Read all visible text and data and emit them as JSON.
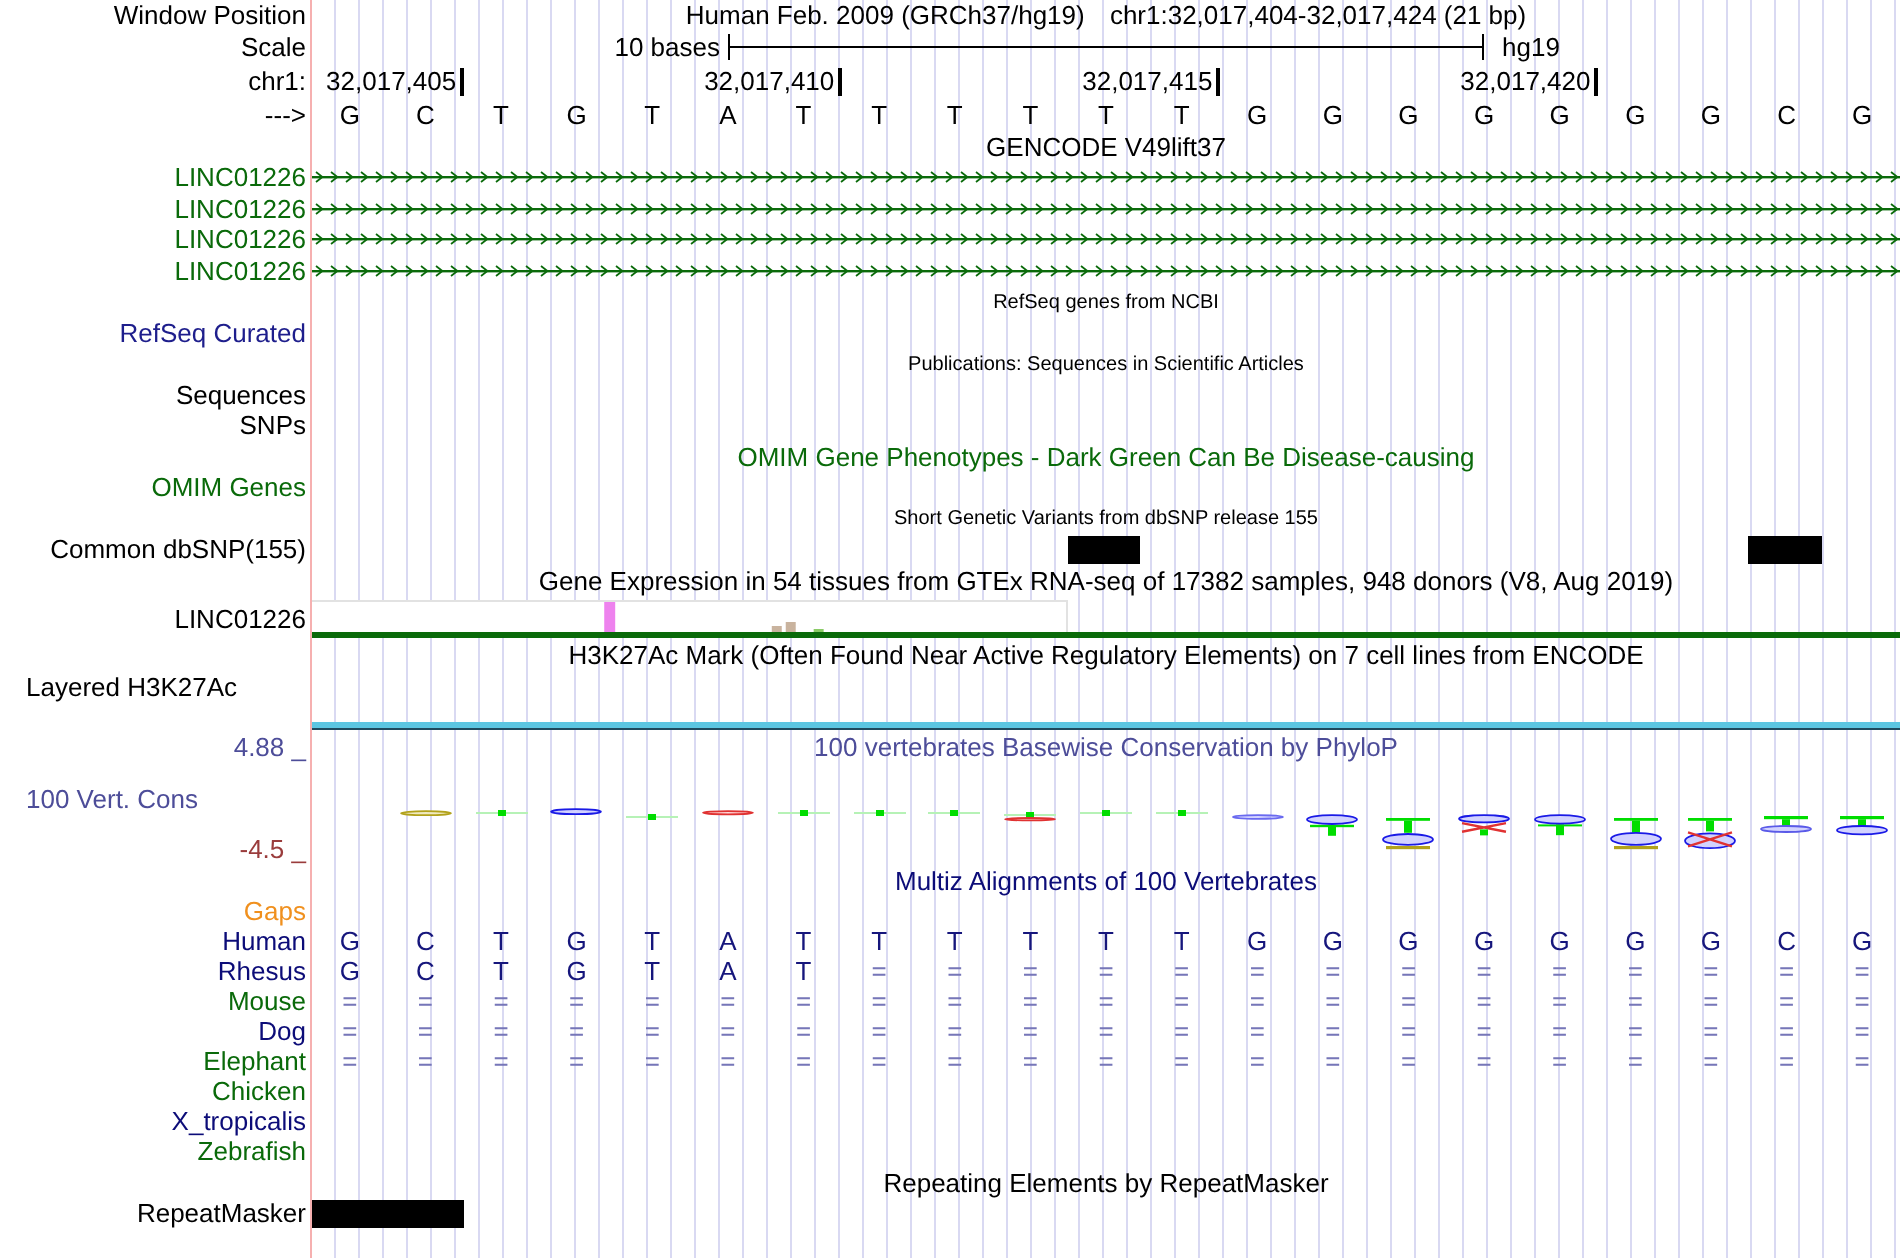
{
  "header": {
    "label": "Window Position",
    "assembly": "Human Feb. 2009 (GRCh37/hg19)",
    "position": "chr1:32,017,404-32,017,424 (21 bp)"
  },
  "scale": {
    "label": "Scale",
    "length": "10 bases",
    "assembly": "hg19"
  },
  "ruler": {
    "label": "chr1:",
    "ticks": [
      "32,017,405",
      "32,017,410",
      "32,017,415",
      "32,017,420"
    ]
  },
  "sequence": {
    "label": "--->",
    "bases": [
      "G",
      "C",
      "T",
      "G",
      "T",
      "A",
      "T",
      "T",
      "T",
      "T",
      "T",
      "T",
      "G",
      "G",
      "G",
      "G",
      "G",
      "G",
      "G",
      "C",
      "G"
    ]
  },
  "tracks": [
    {
      "kind": "title",
      "text": "GENCODE V49lift37",
      "color": "#000000"
    },
    {
      "kind": "gene",
      "label": "LINC01226",
      "color": "#0a6a0a"
    },
    {
      "kind": "gene",
      "label": "LINC01226",
      "color": "#0a6a0a"
    },
    {
      "kind": "gene",
      "label": "LINC01226",
      "color": "#0a6a0a"
    },
    {
      "kind": "gene",
      "label": "LINC01226",
      "color": "#0a6a0a"
    },
    {
      "kind": "note",
      "text": "RefSeq genes from NCBI",
      "color": "#000000"
    },
    {
      "kind": "label",
      "label": "RefSeq Curated",
      "color": "#1e1e8c"
    },
    {
      "kind": "note",
      "text": "Publications: Sequences in Scientific Articles",
      "color": "#000000"
    },
    {
      "kind": "label",
      "label": "Sequences",
      "color": "#000000"
    },
    {
      "kind": "label",
      "label": "SNPs",
      "color": "#000000"
    },
    {
      "kind": "title",
      "text": "OMIM Gene Phenotypes - Dark Green Can Be Disease-causing",
      "color": "#0a6a0a"
    },
    {
      "kind": "label",
      "label": "OMIM Genes",
      "color": "#0a6a0a"
    },
    {
      "kind": "note",
      "text": "Short Genetic Variants from dbSNP release 155",
      "color": "#000000"
    },
    {
      "kind": "features",
      "label": "Common dbSNP(155)",
      "color": "#000000",
      "cells": [
        {
          "kind": "blank"
        },
        {
          "kind": "blank"
        },
        {
          "kind": "blank"
        },
        {
          "kind": "blank"
        },
        {
          "kind": "blank"
        },
        {
          "kind": "blank"
        },
        {
          "kind": "blank"
        },
        {
          "kind": "blank"
        },
        {
          "kind": "blank"
        },
        {
          "kind": "blank"
        },
        {
          "kind": "variant"
        },
        {
          "kind": "blank"
        },
        {
          "kind": "blank"
        },
        {
          "kind": "blank"
        },
        {
          "kind": "blank"
        },
        {
          "kind": "blank"
        },
        {
          "kind": "blank"
        },
        {
          "kind": "blank"
        },
        {
          "kind": "blank"
        },
        {
          "kind": "variant"
        },
        {
          "kind": "blank"
        }
      ]
    },
    {
      "kind": "title",
      "text": "Gene Expression in 54 tissues from GTEx RNA-seq of 17382 samples, 948 donors (V8, Aug 2019)",
      "color": "#000000"
    },
    {
      "kind": "expression",
      "label": "LINC01226",
      "color": "#000000"
    },
    {
      "kind": "title",
      "text": "H3K27Ac Mark (Often Found Near Active Regulatory Elements) on 7 cell lines from ENCODE",
      "color": "#000000"
    },
    {
      "kind": "signal",
      "label": "Layered H3K27Ac",
      "color": "#000000"
    },
    {
      "kind": "conservation",
      "title": "100 vertebrates Basewise Conservation by PhyloP",
      "label": "100 Vert. Cons",
      "max": "4.88 _",
      "min": "-4.5 _",
      "color": "#4d4d99"
    },
    {
      "kind": "title",
      "text": "Multiz Alignments of 100 Vertebrates",
      "color": "#0c0c78"
    },
    {
      "kind": "label",
      "label": "Gaps",
      "color": "#f0901e"
    },
    {
      "kind": "alignment",
      "label": "Human",
      "color": "#0c0c78",
      "cells": [
        {
          "text": "G",
          "kind": "base"
        },
        {
          "text": "C",
          "kind": "base"
        },
        {
          "text": "T",
          "kind": "base"
        },
        {
          "text": "G",
          "kind": "base"
        },
        {
          "text": "T",
          "kind": "base"
        },
        {
          "text": "A",
          "kind": "base"
        },
        {
          "text": "T",
          "kind": "base"
        },
        {
          "text": "T",
          "kind": "base"
        },
        {
          "text": "T",
          "kind": "base"
        },
        {
          "text": "T",
          "kind": "base"
        },
        {
          "text": "T",
          "kind": "base"
        },
        {
          "text": "T",
          "kind": "base"
        },
        {
          "text": "G",
          "kind": "base"
        },
        {
          "text": "G",
          "kind": "base"
        },
        {
          "text": "G",
          "kind": "base"
        },
        {
          "text": "G",
          "kind": "base"
        },
        {
          "text": "G",
          "kind": "base"
        },
        {
          "text": "G",
          "kind": "base"
        },
        {
          "text": "G",
          "kind": "base"
        },
        {
          "text": "C",
          "kind": "base"
        },
        {
          "text": "G",
          "kind": "base"
        }
      ]
    },
    {
      "kind": "alignment",
      "label": "Rhesus",
      "color": "#0c0c78",
      "cells": [
        {
          "text": "G",
          "kind": "base"
        },
        {
          "text": "C",
          "kind": "base"
        },
        {
          "text": "T",
          "kind": "base"
        },
        {
          "text": "G",
          "kind": "base"
        },
        {
          "text": "T",
          "kind": "base"
        },
        {
          "text": "A",
          "kind": "base"
        },
        {
          "text": "T",
          "kind": "base"
        },
        {
          "text": "=",
          "kind": "match"
        },
        {
          "text": "=",
          "kind": "match"
        },
        {
          "text": "=",
          "kind": "match"
        },
        {
          "text": "=",
          "kind": "match"
        },
        {
          "text": "=",
          "kind": "match"
        },
        {
          "text": "=",
          "kind": "match"
        },
        {
          "text": "=",
          "kind": "match"
        },
        {
          "text": "=",
          "kind": "match"
        },
        {
          "text": "=",
          "kind": "match"
        },
        {
          "text": "=",
          "kind": "match"
        },
        {
          "text": "=",
          "kind": "match"
        },
        {
          "text": "=",
          "kind": "match"
        },
        {
          "text": "=",
          "kind": "match"
        },
        {
          "text": "=",
          "kind": "match"
        }
      ]
    },
    {
      "kind": "alignment",
      "label": "Mouse",
      "color": "#0a6a0a",
      "cells": [
        {
          "text": "=",
          "kind": "match"
        },
        {
          "text": "=",
          "kind": "match"
        },
        {
          "text": "=",
          "kind": "match"
        },
        {
          "text": "=",
          "kind": "match"
        },
        {
          "text": "=",
          "kind": "match"
        },
        {
          "text": "=",
          "kind": "match"
        },
        {
          "text": "=",
          "kind": "match"
        },
        {
          "text": "=",
          "kind": "match"
        },
        {
          "text": "=",
          "kind": "match"
        },
        {
          "text": "=",
          "kind": "match"
        },
        {
          "text": "=",
          "kind": "match"
        },
        {
          "text": "=",
          "kind": "match"
        },
        {
          "text": "=",
          "kind": "match"
        },
        {
          "text": "=",
          "kind": "match"
        },
        {
          "text": "=",
          "kind": "match"
        },
        {
          "text": "=",
          "kind": "match"
        },
        {
          "text": "=",
          "kind": "match"
        },
        {
          "text": "=",
          "kind": "match"
        },
        {
          "text": "=",
          "kind": "match"
        },
        {
          "text": "=",
          "kind": "match"
        },
        {
          "text": "=",
          "kind": "match"
        }
      ]
    },
    {
      "kind": "alignment",
      "label": "Dog",
      "color": "#0c0c78",
      "cells": [
        {
          "text": "=",
          "kind": "match"
        },
        {
          "text": "=",
          "kind": "match"
        },
        {
          "text": "=",
          "kind": "match"
        },
        {
          "text": "=",
          "kind": "match"
        },
        {
          "text": "=",
          "kind": "match"
        },
        {
          "text": "=",
          "kind": "match"
        },
        {
          "text": "=",
          "kind": "match"
        },
        {
          "text": "=",
          "kind": "match"
        },
        {
          "text": "=",
          "kind": "match"
        },
        {
          "text": "=",
          "kind": "match"
        },
        {
          "text": "=",
          "kind": "match"
        },
        {
          "text": "=",
          "kind": "match"
        },
        {
          "text": "=",
          "kind": "match"
        },
        {
          "text": "=",
          "kind": "match"
        },
        {
          "text": "=",
          "kind": "match"
        },
        {
          "text": "=",
          "kind": "match"
        },
        {
          "text": "=",
          "kind": "match"
        },
        {
          "text": "=",
          "kind": "match"
        },
        {
          "text": "=",
          "kind": "match"
        },
        {
          "text": "=",
          "kind": "match"
        },
        {
          "text": "=",
          "kind": "match"
        }
      ]
    },
    {
      "kind": "alignment",
      "label": "Elephant",
      "color": "#0a6a0a",
      "cells": [
        {
          "text": "=",
          "kind": "match"
        },
        {
          "text": "=",
          "kind": "match"
        },
        {
          "text": "=",
          "kind": "match"
        },
        {
          "text": "=",
          "kind": "match"
        },
        {
          "text": "=",
          "kind": "match"
        },
        {
          "text": "=",
          "kind": "match"
        },
        {
          "text": "=",
          "kind": "match"
        },
        {
          "text": "=",
          "kind": "match"
        },
        {
          "text": "=",
          "kind": "match"
        },
        {
          "text": "=",
          "kind": "match"
        },
        {
          "text": "=",
          "kind": "match"
        },
        {
          "text": "=",
          "kind": "match"
        },
        {
          "text": "=",
          "kind": "match"
        },
        {
          "text": "=",
          "kind": "match"
        },
        {
          "text": "=",
          "kind": "match"
        },
        {
          "text": "=",
          "kind": "match"
        },
        {
          "text": "=",
          "kind": "match"
        },
        {
          "text": "=",
          "kind": "match"
        },
        {
          "text": "=",
          "kind": "match"
        },
        {
          "text": "=",
          "kind": "match"
        },
        {
          "text": "=",
          "kind": "match"
        }
      ]
    },
    {
      "kind": "alignment",
      "label": "Chicken",
      "color": "#0a6a0a"
    },
    {
      "kind": "alignment",
      "label": "X_tropicalis",
      "color": "#0c0c78"
    },
    {
      "kind": "alignment",
      "label": "Zebrafish",
      "color": "#0a6a0a"
    },
    {
      "kind": "title",
      "text": "Repeating Elements by RepeatMasker",
      "color": "#000000"
    },
    {
      "kind": "features",
      "label": "RepeatMasker",
      "color": "#000000",
      "cells": [
        {
          "kind": "repeat"
        },
        {
          "kind": "repeat"
        },
        {
          "kind": "blank"
        },
        {
          "kind": "blank"
        },
        {
          "kind": "blank"
        },
        {
          "kind": "blank"
        },
        {
          "kind": "blank"
        },
        {
          "kind": "blank"
        },
        {
          "kind": "blank"
        },
        {
          "kind": "blank"
        },
        {
          "kind": "blank"
        },
        {
          "kind": "blank"
        },
        {
          "kind": "blank"
        },
        {
          "kind": "blank"
        },
        {
          "kind": "blank"
        },
        {
          "kind": "blank"
        },
        {
          "kind": "blank"
        },
        {
          "kind": "blank"
        },
        {
          "kind": "blank"
        },
        {
          "kind": "blank"
        },
        {
          "kind": "blank"
        }
      ]
    }
  ]
}
